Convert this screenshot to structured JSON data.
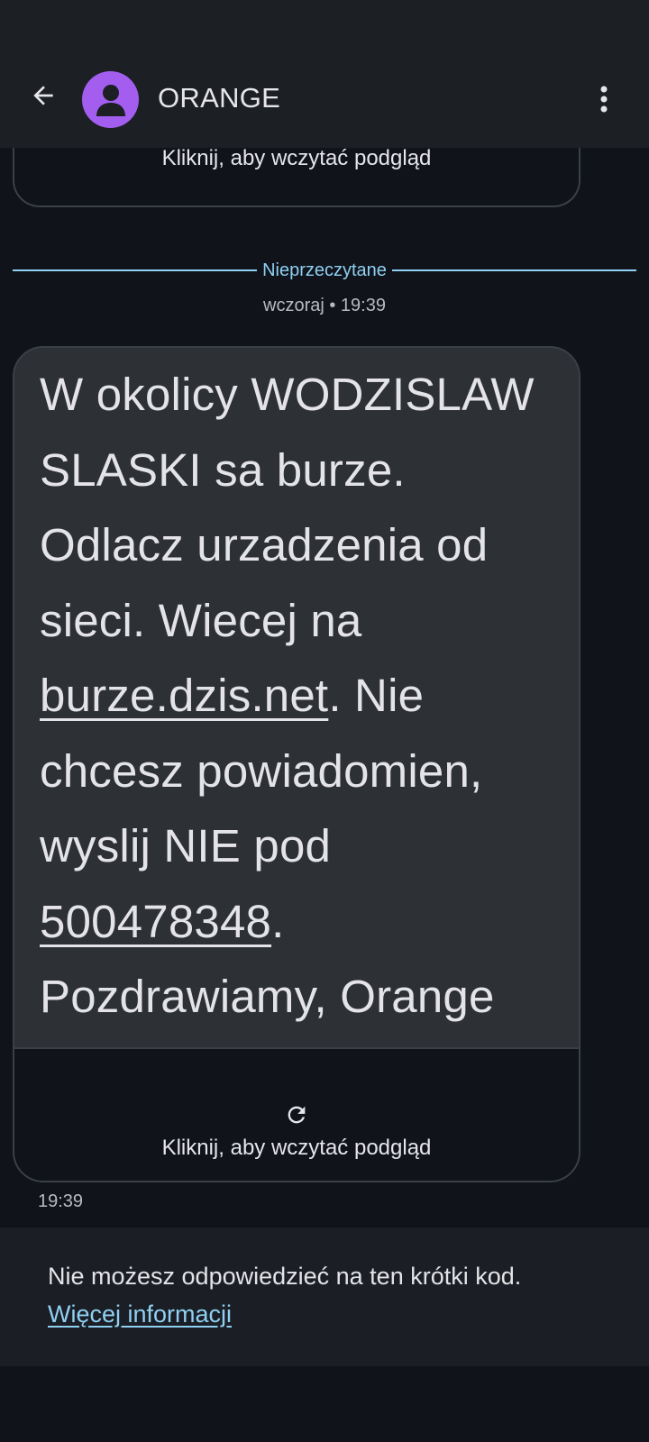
{
  "header": {
    "contact_name": "ORANGE",
    "back_icon": "arrow-back-icon",
    "avatar_icon": "person-icon",
    "avatar_color": "#a35ef0",
    "more_icon": "more-vert-icon"
  },
  "previous_preview": {
    "text": "Kliknij, aby wczytać podgląd"
  },
  "unread_divider": {
    "label": "Nieprzeczytane",
    "color": "#8fd0f3"
  },
  "date_label": "wczoraj • 19:39",
  "message": {
    "lines": {
      "l1": "W okolicy WODZISLAW",
      "l2": "SLASKI sa burze.",
      "l3": "Odlacz urzadzenia od",
      "l4": "sieci. Wiecej na",
      "l5_link": "burze.dzis.net",
      "l5_rest": ". Nie",
      "l6": "chcesz powiadomien,",
      "l7": "wyslij NIE pod",
      "l8_link": "500478348",
      "l8_rest": ".",
      "l9": "Pozdrawiamy, Orange"
    },
    "preview_text": "Kliknij, aby wczytać podgląd",
    "refresh_icon": "refresh-icon",
    "time": "19:39"
  },
  "info_panel": {
    "text": "Nie możesz odpowiedzieć na ten krótki kod.",
    "link": "Więcej informacji"
  }
}
